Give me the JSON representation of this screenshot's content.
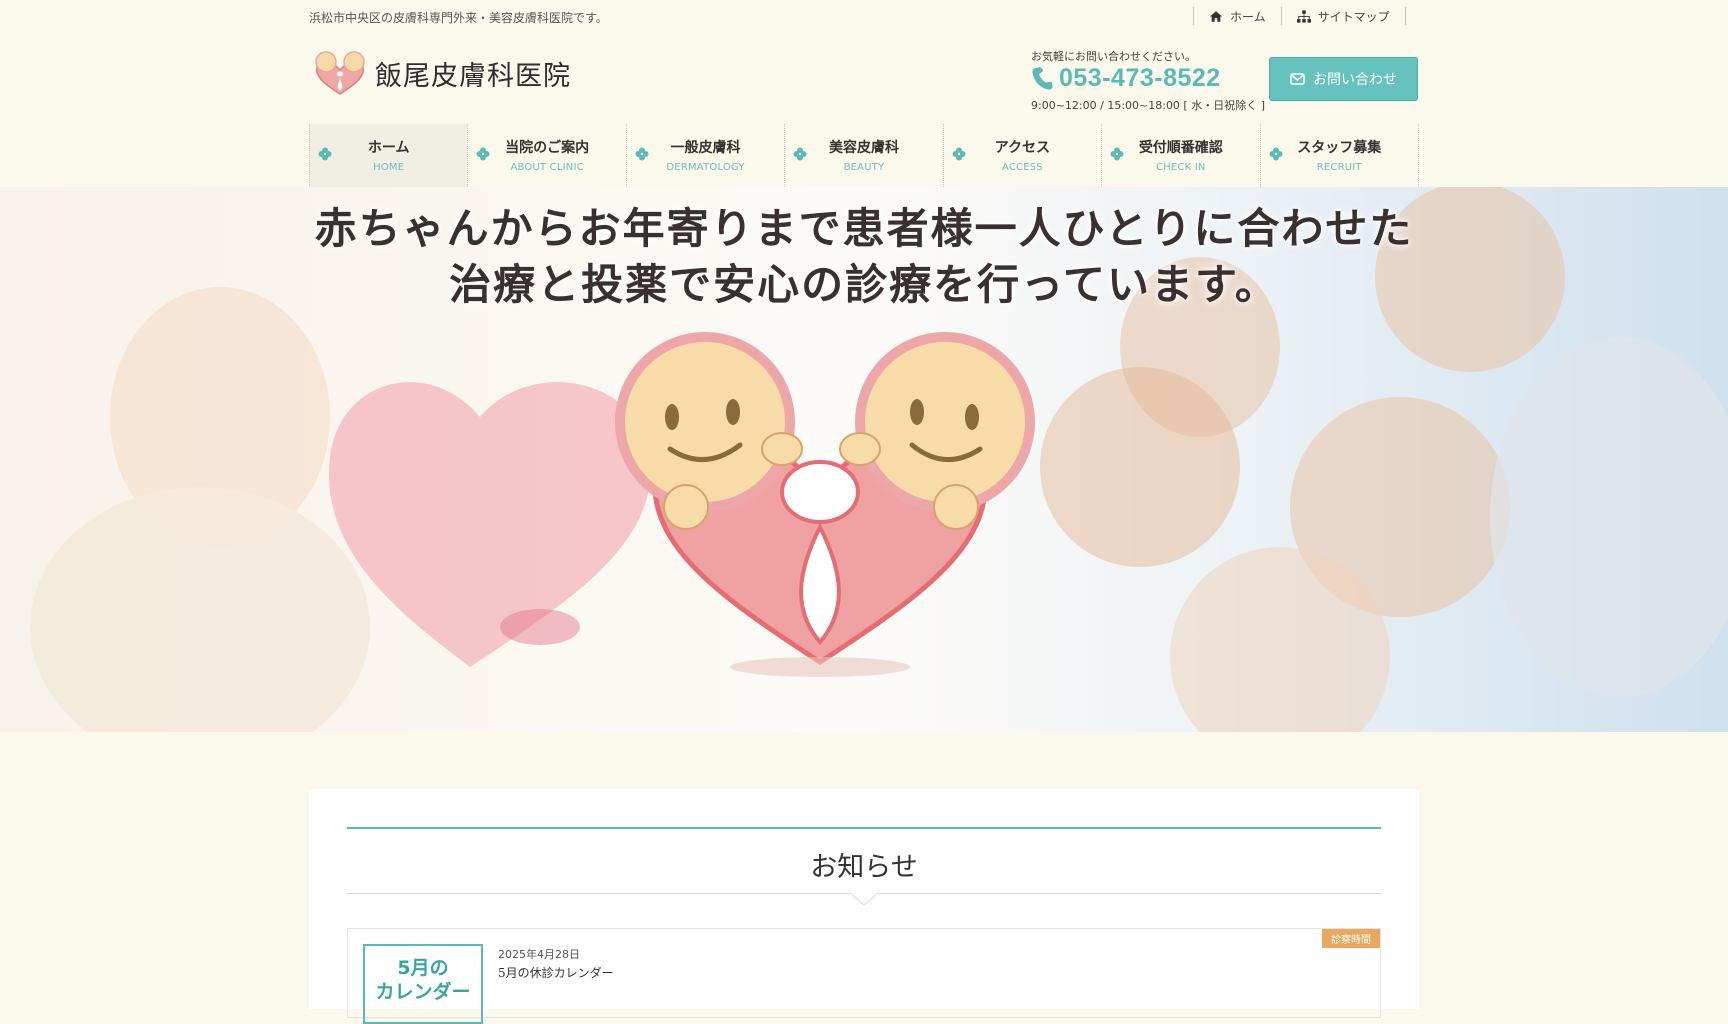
{
  "header": {
    "tagline": "浜松市中央区の皮膚科専門外来・美容皮膚科医院です。",
    "toplinks": [
      {
        "label": "ホーム",
        "icon": "home-icon"
      },
      {
        "label": "サイトマップ",
        "icon": "sitemap-icon"
      }
    ],
    "logo_text": "飯尾皮膚科医院",
    "contact_lead": "お気軽にお問い合わせください。",
    "phone": "053-473-8522",
    "hours": "9:00~12:00 / 15:00~18:00 [ 水・日祝除く ]",
    "contact_button": "お問い合わせ"
  },
  "nav": [
    {
      "ja": "ホーム",
      "en": "HOME",
      "active": true
    },
    {
      "ja": "当院のご案内",
      "en": "ABOUT CLINIC"
    },
    {
      "ja": "一般皮膚科",
      "en": "DERMATOLOGY"
    },
    {
      "ja": "美容皮膚科",
      "en": "BEAUTY"
    },
    {
      "ja": "アクセス",
      "en": "ACCESS"
    },
    {
      "ja": "受付順番確認",
      "en": "CHECK IN"
    },
    {
      "ja": "スタッフ募集",
      "en": "RECRUIT"
    }
  ],
  "hero": {
    "line1": "赤ちゃんからお年寄りまで患者様一人ひとりに合わせた",
    "line2": "治療と投薬で安心の診療を行っています。"
  },
  "news": {
    "title": "お知らせ",
    "items": [
      {
        "date": "2025年4月28日",
        "title": "5月の休診カレンダー",
        "badge": "診察時間",
        "thumb_line1": "5月の",
        "thumb_line2": "カレンダー"
      }
    ]
  },
  "colors": {
    "accent": "#5bbab5",
    "background": "#fbf8ec",
    "badge": "#e7a85f",
    "heart": "#f0a6a4"
  }
}
